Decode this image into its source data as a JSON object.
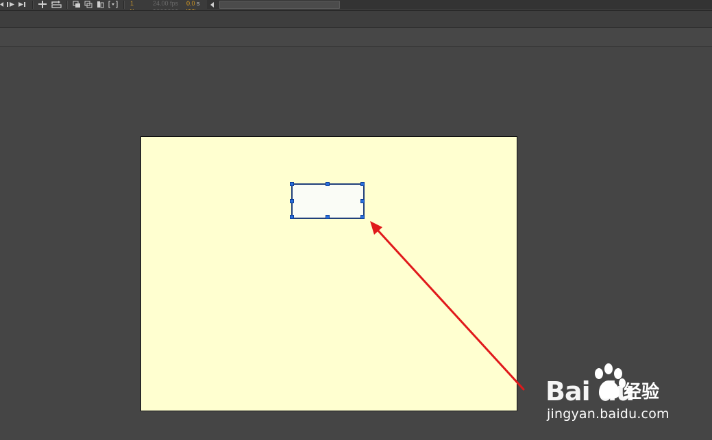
{
  "timeline": {
    "frame_number": "1",
    "fps": "24.00 fps",
    "elapsed_value": "0.0",
    "elapsed_unit": "s"
  },
  "icons": {
    "step-back": "step-back-icon",
    "play": "play-icon",
    "go-to-end": "go-to-end-icon",
    "center-frame": "center-frame-icon",
    "loop": "loop-icon",
    "onion-skin": "onion-skin-icon",
    "onion-skin-outlines": "onion-skin-outlines-icon",
    "edit-multiple-frames": "edit-multiple-frames-icon",
    "modify-onion-markers": "modify-onion-markers-icon",
    "scroll-left": "scroll-left-icon",
    "watermark-paw": "paw-icon"
  },
  "stage": {
    "background_color": "#ffffd0",
    "shape_fill": "#fafcf6",
    "shape_stroke": "#1f3f7a",
    "selection_handle_color": "#2a6fdb"
  },
  "annotation": {
    "arrow_color": "#e0191b"
  },
  "watermark": {
    "brand": "Bai du",
    "brand_suffix": "经验",
    "url": "jingyan.baidu.com"
  }
}
